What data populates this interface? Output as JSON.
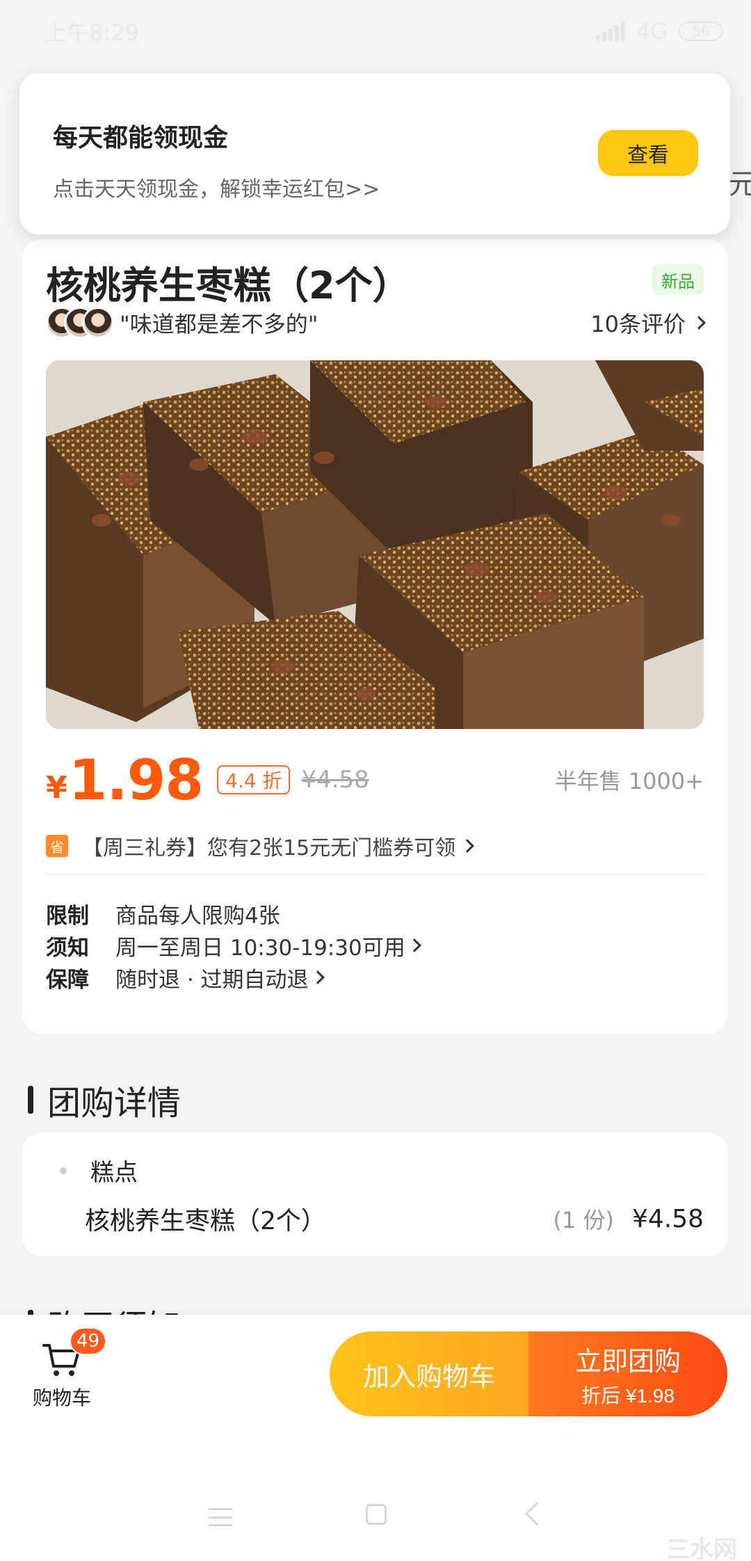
{
  "status_bar": {
    "time": "上午8:29",
    "network": "4G",
    "battery": "56"
  },
  "notice": {
    "title": "每天都能领现金",
    "subtitle": "点击天天领现金，解锁幸运红包>>",
    "button": "查看",
    "edge_char": "元"
  },
  "product": {
    "title": "核桃养生枣糕（2个）",
    "badge": "新品",
    "review_quote": "\"味道都是差不多的\"",
    "review_count": "10条评价",
    "price_currency": "¥",
    "price": "1.98",
    "discount": "4.4 折",
    "original_price": "¥4.58",
    "sales": "半年售 1000+",
    "coupon_icon": "省",
    "coupon_text": "【周三礼券】您有2张15元无门槛券可领",
    "info": [
      {
        "label": "限制",
        "value": "商品每人限购4张"
      },
      {
        "label": "须知",
        "value": "周一至周日 10:30-19:30可用"
      },
      {
        "label": "保障",
        "value": "随时退 · 过期自动退"
      }
    ]
  },
  "group_detail": {
    "section_title": "团购详情",
    "category": "糕点",
    "item_name": "核桃养生枣糕（2个）",
    "item_qty": "(1 份)",
    "item_price": "¥4.58"
  },
  "next_section_title": "购买须知",
  "bottom_bar": {
    "cart_label": "购物车",
    "cart_count": "49",
    "add_cart": "加入购物车",
    "buy_now": "立即团购",
    "buy_now_sub": "折后 ¥1.98"
  },
  "watermark": "三水网",
  "colors": {
    "accent_orange": "#ff5a0a",
    "button_yellow": "#ffc70e",
    "badge_green": "#3ba83b"
  }
}
